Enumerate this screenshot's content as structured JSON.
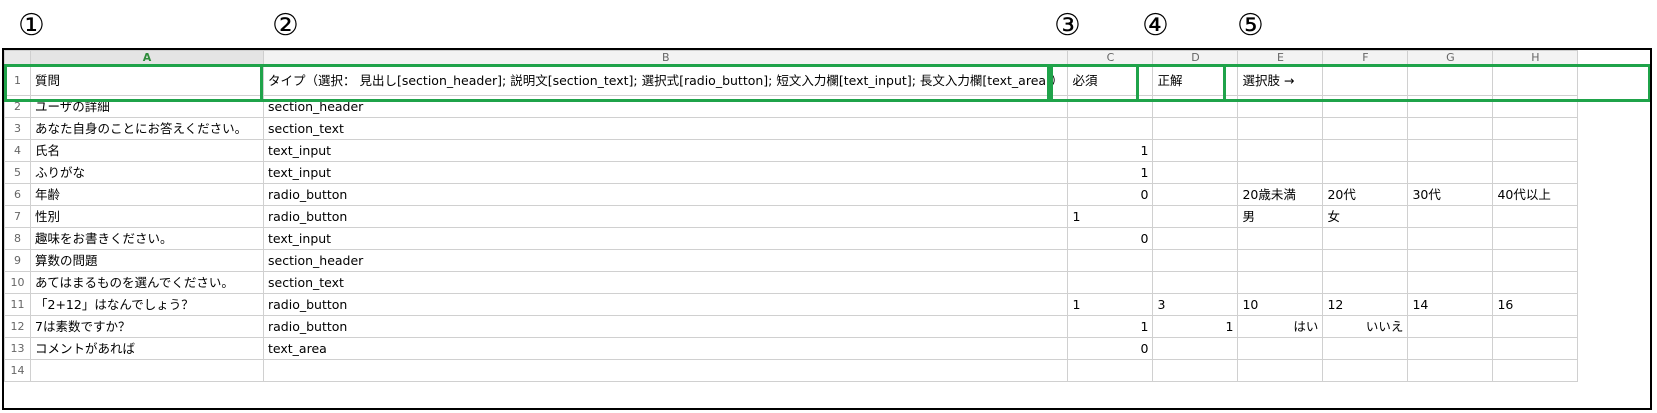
{
  "markers": [
    "①",
    "②",
    "③",
    "④",
    "⑤"
  ],
  "columns": [
    "A",
    "B",
    "C",
    "D",
    "E",
    "F",
    "G",
    "H"
  ],
  "rows": [
    {
      "n": "1",
      "cells": [
        "質問",
        "タイプ（選択： 見出し[section_header]; 説明文[section_text]; 選択式[radio_button]; 短文入力欄[text_input]; 長文入力欄[text_area]）",
        "必須",
        "正解",
        "選択肢 →",
        "",
        "",
        ""
      ]
    },
    {
      "n": "2",
      "cells": [
        "ユーザの詳細",
        "section_header",
        "",
        "",
        "",
        "",
        "",
        ""
      ]
    },
    {
      "n": "3",
      "cells": [
        "あなた自身のことにお答えください。",
        "section_text",
        "",
        "",
        "",
        "",
        "",
        ""
      ]
    },
    {
      "n": "4",
      "cells": [
        "氏名",
        "text_input",
        "1",
        "",
        "",
        "",
        "",
        ""
      ]
    },
    {
      "n": "5",
      "cells": [
        "ふりがな",
        "text_input",
        "1",
        "",
        "",
        "",
        "",
        ""
      ]
    },
    {
      "n": "6",
      "cells": [
        "年齢",
        "radio_button",
        "0",
        "",
        "20歳未満",
        "20代",
        "30代",
        "40代以上"
      ]
    },
    {
      "n": "7",
      "cells": [
        "性別",
        "radio_button",
        "1",
        "",
        "男",
        "女",
        "",
        ""
      ]
    },
    {
      "n": "8",
      "cells": [
        "趣味をお書きください。",
        "text_input",
        "0",
        "",
        "",
        "",
        "",
        ""
      ]
    },
    {
      "n": "9",
      "cells": [
        "算数の問題",
        "section_header",
        "",
        "",
        "",
        "",
        "",
        ""
      ]
    },
    {
      "n": "10",
      "cells": [
        "あてはまるものを選んでください。",
        "section_text",
        "",
        "",
        "",
        "",
        "",
        ""
      ]
    },
    {
      "n": "11",
      "cells": [
        "「2+12」はなんでしょう？",
        "radio_button",
        "1",
        "3",
        "10",
        "12",
        "14",
        "16"
      ]
    },
    {
      "n": "12",
      "cells": [
        "7は素数ですか？",
        "radio_button",
        "1",
        "1",
        "はい",
        "いいえ",
        "",
        ""
      ]
    },
    {
      "n": "13",
      "cells": [
        "コメントがあれば",
        "text_area",
        "0",
        "",
        "",
        "",
        "",
        ""
      ]
    },
    {
      "n": "14",
      "cells": [
        "",
        "",
        "",
        "",
        "",
        "",
        "",
        ""
      ]
    }
  ],
  "numeric_cells": [
    "3.2",
    "4.2",
    "5.2",
    "7.2",
    "8.2",
    "11.2",
    "11.3",
    "11.4",
    "11.5",
    "11.6",
    "11.7",
    "12.2",
    "12.3",
    "13.2"
  ],
  "colors": {
    "highlight": "#1fa34a",
    "active_col": "#2e8b3a"
  }
}
